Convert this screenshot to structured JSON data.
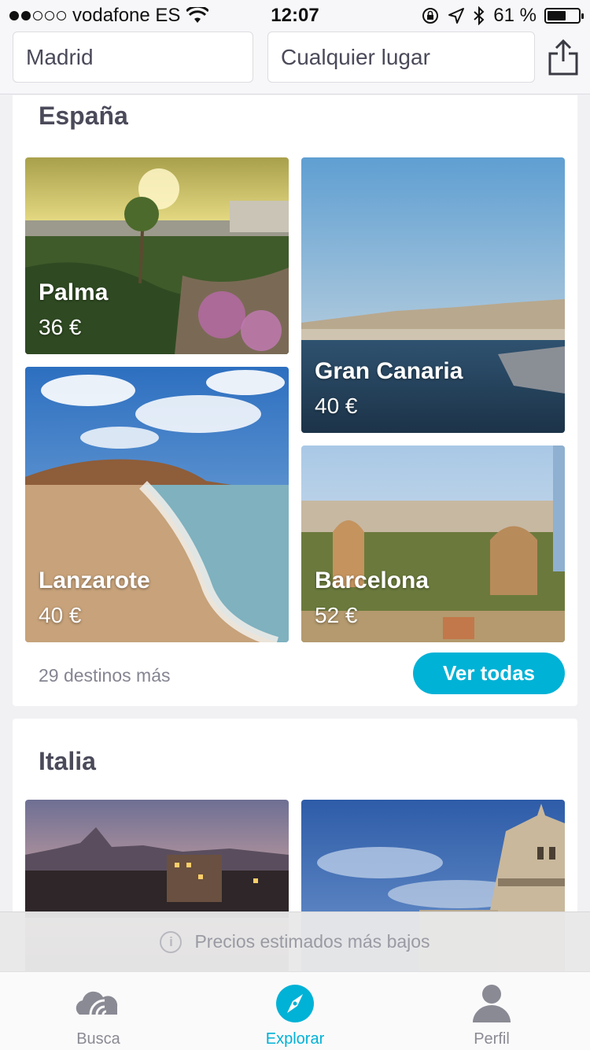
{
  "status_bar": {
    "carrier": "vodafone ES",
    "signal_dots_filled": 2,
    "signal_dots_total": 5,
    "time": "12:07",
    "battery_percent_text": "61 %",
    "battery_level": 0.61
  },
  "search": {
    "origin_value": "Madrid",
    "destination_placeholder": "Cualquier lugar"
  },
  "sections": [
    {
      "title": "España",
      "destinations": [
        {
          "name": "Palma",
          "price": "36 €"
        },
        {
          "name": "Gran Canaria",
          "price": "40 €"
        },
        {
          "name": "Lanzarote",
          "price": "40 €"
        },
        {
          "name": "Barcelona",
          "price": "52 €"
        }
      ],
      "more_text": "29 destinos más",
      "view_all_label": "Ver todas"
    },
    {
      "title": "Italia"
    }
  ],
  "notice": {
    "text": "Precios estimados más bajos",
    "icon": "info-icon"
  },
  "tabs": [
    {
      "label": "Busca",
      "icon": "cloud-wifi-icon",
      "active": false
    },
    {
      "label": "Explorar",
      "icon": "compass-icon",
      "active": true
    },
    {
      "label": "Perfil",
      "icon": "person-icon",
      "active": false
    }
  ],
  "colors": {
    "accent": "#00b2d6",
    "text": "#4a4a5a",
    "muted": "#858592"
  }
}
